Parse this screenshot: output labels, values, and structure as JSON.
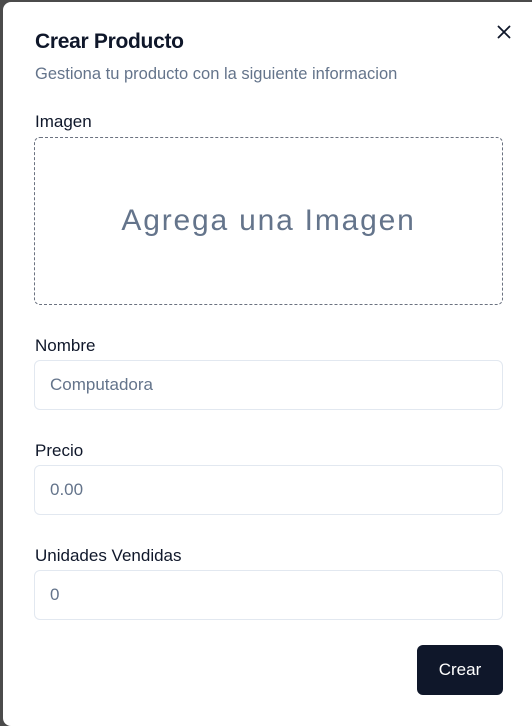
{
  "dialog": {
    "title": "Crear Producto",
    "subtitle": "Gestiona tu producto con la siguiente informacion",
    "close_icon": "close-icon"
  },
  "image_field": {
    "label": "Imagen",
    "dropzone_text": "Agrega una Imagen"
  },
  "name_field": {
    "label": "Nombre",
    "placeholder": "Computadora",
    "value": ""
  },
  "price_field": {
    "label": "Precio",
    "placeholder": "0.00",
    "value": ""
  },
  "units_field": {
    "label": "Unidades Vendidas",
    "placeholder": "0",
    "value": ""
  },
  "actions": {
    "submit_label": "Crear"
  },
  "colors": {
    "primary": "#0f172a",
    "muted_text": "#64748b",
    "border": "#e2e8f0",
    "overlay": "#4b4b4b"
  }
}
